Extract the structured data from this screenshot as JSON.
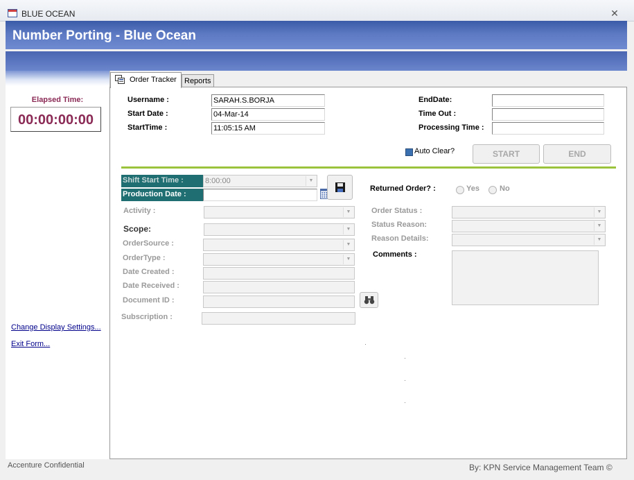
{
  "window": {
    "title": "BLUE OCEAN",
    "close_glyph": "✕",
    "banner_title": "Number Porting - Blue Ocean"
  },
  "sidebar": {
    "elapsed_label": "Elapsed Time:",
    "elapsed_value": "00:00:00:00",
    "links": [
      "Change Display Settings...",
      "Exit Form..."
    ],
    "confidential": "Accenture Confidential"
  },
  "tabs": [
    {
      "label": "Order Tracker",
      "active": true,
      "icon": "order-tracker-icon"
    },
    {
      "label": "Reports",
      "active": false
    }
  ],
  "header_fields": {
    "username": {
      "label": "Username :",
      "value": "SARAH.S.BORJA"
    },
    "start_date": {
      "label": "Start Date :",
      "value": "04-Mar-14"
    },
    "start_time": {
      "label": "StartTime :",
      "value": "11:05:15 AM"
    },
    "end_date": {
      "label": "EndDate:",
      "value": ""
    },
    "time_out": {
      "label": "Time Out :",
      "value": ""
    },
    "processing_time": {
      "label": "Processing Time :",
      "value": ""
    }
  },
  "auto_clear": {
    "label": "Auto Clear?",
    "checked": true
  },
  "buttons": {
    "start": "START",
    "end": "END"
  },
  "order_form": {
    "shift_start_time": {
      "label": "Shift Start Time :",
      "value": "8:00:00"
    },
    "production_date": {
      "label": "Production Date :",
      "value": ""
    },
    "activity": {
      "label": "Activity :",
      "value": ""
    },
    "scope": {
      "label": "Scope:",
      "value": ""
    },
    "order_source": {
      "label": "OrderSource :",
      "value": ""
    },
    "order_type": {
      "label": "OrderType :",
      "value": ""
    },
    "date_created": {
      "label": "Date Created :",
      "value": ""
    },
    "date_received": {
      "label": "Date Received :",
      "value": ""
    },
    "document_id": {
      "label": "Document ID :",
      "value": ""
    },
    "subscription": {
      "label": "Subscription :",
      "value": ""
    }
  },
  "order_status_form": {
    "returned_order": {
      "label": "Returned Order? :",
      "yes": "Yes",
      "no": "No"
    },
    "order_status": {
      "label": "Order Status :",
      "value": ""
    },
    "status_reason": {
      "label": "Status Reason:",
      "value": ""
    },
    "reason_details": {
      "label": "Reason Details:",
      "value": ""
    },
    "comments": {
      "label": "Comments :",
      "value": ""
    }
  },
  "icons": {
    "save": "save-icon",
    "calendar": "calendar-icon",
    "binoculars": "binoculars-icon"
  },
  "footer": {
    "credit": "By: KPN Service Management Team ©"
  },
  "colors": {
    "banner": "#4a66b2",
    "accent_line": "#9bc33c",
    "elapsed": "#8a2a55",
    "highlight": "#1f6e72",
    "link": "#00008b"
  }
}
